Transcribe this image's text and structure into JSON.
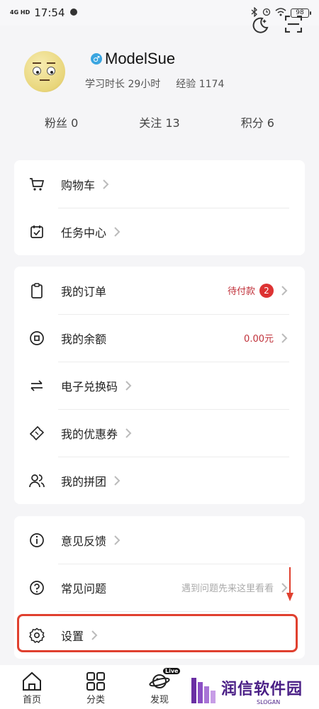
{
  "status_bar": {
    "network": "4G HD",
    "time": "17:54",
    "battery": "98"
  },
  "profile": {
    "username": "ModelSue",
    "gender_symbol": "♂",
    "study_time_label": "学习时长",
    "study_time_value": "29小时",
    "exp_label": "经验",
    "exp_value": "1174"
  },
  "follow": {
    "fans_label": "粉丝",
    "fans_value": "0",
    "following_label": "关注",
    "following_value": "13",
    "points_label": "积分",
    "points_value": "6"
  },
  "card1": [
    {
      "label": "购物车",
      "icon": "cart-icon"
    },
    {
      "label": "任务中心",
      "icon": "calendar-check-icon"
    }
  ],
  "card2": [
    {
      "label": "我的订单",
      "icon": "clipboard-icon",
      "extra": "待付款",
      "badge": "2"
    },
    {
      "label": "我的余额",
      "icon": "coin-icon",
      "extra": "0.00元"
    },
    {
      "label": "电子兑换码",
      "icon": "exchange-icon"
    },
    {
      "label": "我的优惠券",
      "icon": "ticket-icon"
    },
    {
      "label": "我的拼团",
      "icon": "group-icon"
    }
  ],
  "card3": [
    {
      "label": "意见反馈",
      "icon": "info-icon"
    },
    {
      "label": "常见问题",
      "icon": "question-icon",
      "extra": "遇到问题先来这里看看"
    },
    {
      "label": "设置",
      "icon": "gear-icon"
    }
  ],
  "bottom_nav": [
    {
      "label": "首页",
      "icon": "home-icon"
    },
    {
      "label": "分类",
      "icon": "grid-icon"
    },
    {
      "label": "发现",
      "icon": "planet-icon",
      "tag": "Live"
    }
  ],
  "watermark": {
    "title": "润信软件园",
    "subtitle": "SLOGAN"
  },
  "colors": {
    "accent_red": "#c0313a",
    "highlight": "#e0402f",
    "gender_blue": "#3aa5e0"
  }
}
